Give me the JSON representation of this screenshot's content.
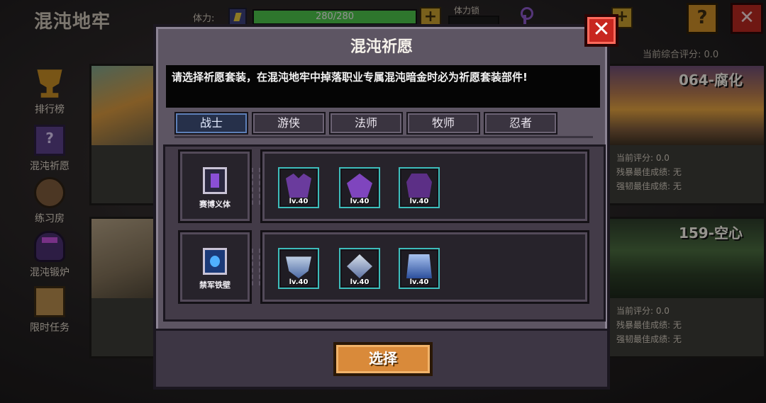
{
  "header": {
    "game_title": "混沌地牢",
    "stamina_label": "体力:",
    "stamina_value": "280/280",
    "stamina_fraction": 1.0,
    "stamina_lock_label": "体力锁",
    "plus_glyph": "+",
    "help_glyph": "?",
    "close_glyph": "✕"
  },
  "overall_score": "当前综合评分: 0.0",
  "sidebar": {
    "items": [
      {
        "label": "排行榜",
        "icon": "trophy-icon"
      },
      {
        "label": "混沌祈愿",
        "icon": "wish-book-icon"
      },
      {
        "label": "练习房",
        "icon": "training-dummy-icon"
      },
      {
        "label": "混沌锻炉",
        "icon": "forge-icon"
      },
      {
        "label": "限时任务",
        "icon": "scroll-icon"
      }
    ]
  },
  "dungeon_cards": [
    {
      "name": "064-腐化",
      "stats": [
        "当前评分: 0.0",
        "残暴最佳成绩: 无",
        "强韧最佳成绩: 无"
      ]
    },
    {
      "name": "159-空心",
      "stats": [
        "当前评分: 0.0",
        "残暴最佳成绩: 无",
        "强韧最佳成绩: 无"
      ]
    }
  ],
  "modal": {
    "title": "混沌祈愿",
    "close_glyph": "✕",
    "notice": "请选择祈愿套装，在混沌地牢中掉落职业专属混沌暗金时必为祈愿套装部件!",
    "tabs": [
      "战士",
      "游侠",
      "法师",
      "牧师",
      "忍者"
    ],
    "active_tab": "战士",
    "sets": [
      {
        "name": "赛博义体",
        "icon": "cyber-implant-icon",
        "items": [
          {
            "level": "lv.40",
            "icon": "purple-helmet-icon"
          },
          {
            "level": "lv.40",
            "icon": "purple-armor-icon"
          },
          {
            "level": "lv.40",
            "icon": "purple-gauntlet-icon"
          }
        ]
      },
      {
        "name": "禁军铁壁",
        "icon": "royal-guard-icon",
        "items": [
          {
            "level": "lv.40",
            "icon": "silver-shoulder-icon"
          },
          {
            "level": "lv.40",
            "icon": "silver-helmet-icon"
          },
          {
            "level": "lv.40",
            "icon": "silver-chest-icon"
          }
        ]
      }
    ],
    "select_label": "选择"
  },
  "colors": {
    "modal_bg": "#5d5563",
    "active_tab": "#26304a",
    "select_button": "#d98a3a",
    "close_button": "#c8261f",
    "item_border": "#3dbdbb"
  }
}
